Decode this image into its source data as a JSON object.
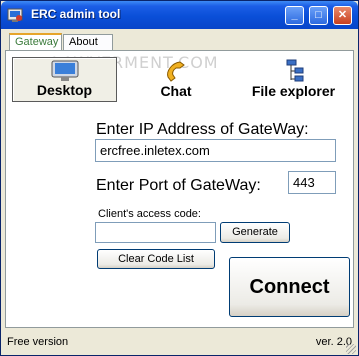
{
  "window": {
    "title": "ERC admin tool",
    "minimize_symbol": "_",
    "maximize_symbol": "□",
    "close_symbol": "✕"
  },
  "tabs": [
    {
      "label": "Gateway",
      "active": true
    },
    {
      "label": "About",
      "active": false
    }
  ],
  "watermark": "LAWYERMENT.COM",
  "modes": [
    {
      "label": "Desktop",
      "icon": "monitor-icon",
      "selected": true
    },
    {
      "label": "Chat",
      "icon": "telephone-icon",
      "selected": false
    },
    {
      "label": "File explorer",
      "icon": "file-tree-icon",
      "selected": false
    }
  ],
  "gateway": {
    "ip_label": "Enter IP Address of GateWay:",
    "ip_value": "ercfree.inletex.com",
    "port_label": "Enter Port of GateWay:",
    "port_value": "443",
    "access_code_label": "Client's access code:",
    "access_code_value": ""
  },
  "buttons": {
    "generate": "Generate",
    "clear_code_list": "Clear Code List",
    "connect": "Connect"
  },
  "status": {
    "left": "Free version",
    "right": "ver. 2.0"
  },
  "colors": {
    "titlebar": "#0a4fd8",
    "active_tab_text": "#3b7b3b",
    "window_bg": "#ece9d8"
  }
}
